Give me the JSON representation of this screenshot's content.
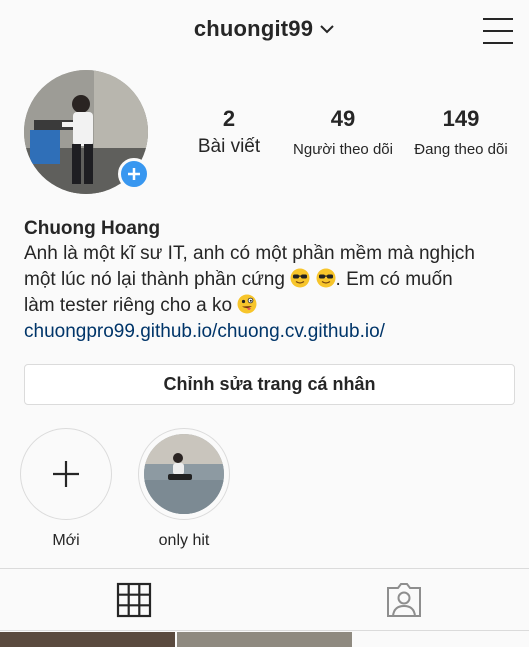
{
  "header": {
    "username": "chuongit99",
    "icons": [
      "chevron-down-icon",
      "menu-icon"
    ]
  },
  "profile": {
    "add_story_icon": "plus-icon",
    "stats": [
      {
        "value": "2",
        "label": "Bài viết"
      },
      {
        "value": "49",
        "label": "Người theo dõi"
      },
      {
        "value": "149",
        "label": "Đang theo dõi"
      }
    ],
    "full_name": "Chuong Hoang",
    "bio": {
      "line1": "Anh là một kĩ sư IT, anh có một phần mềm mà nghịch",
      "line2_text": "một lúc nó lại thành phần cứng",
      "line2_tail": ". Em có muốn",
      "line3_text": "làm tester riêng cho a ko",
      "emojis": [
        "sunglasses-emoji",
        "sunglasses-emoji",
        "zany-face-emoji"
      ]
    },
    "link": "chuongpro99.github.io/chuong.cv.github.io/"
  },
  "edit_button": {
    "label": "Chỉnh sửa trang cá nhân"
  },
  "highlights": [
    {
      "label": "Mới",
      "icon": "plus-icon"
    },
    {
      "label": "only hit"
    }
  ],
  "tabs": [
    {
      "name": "grid",
      "icon": "grid-icon",
      "active": true
    },
    {
      "name": "tagged",
      "icon": "tagged-person-icon",
      "active": false
    }
  ],
  "colors": {
    "background": "#fafafa",
    "text": "#262626",
    "link": "#003569",
    "accent_blue": "#3897f0",
    "border": "#dbdbdb"
  }
}
